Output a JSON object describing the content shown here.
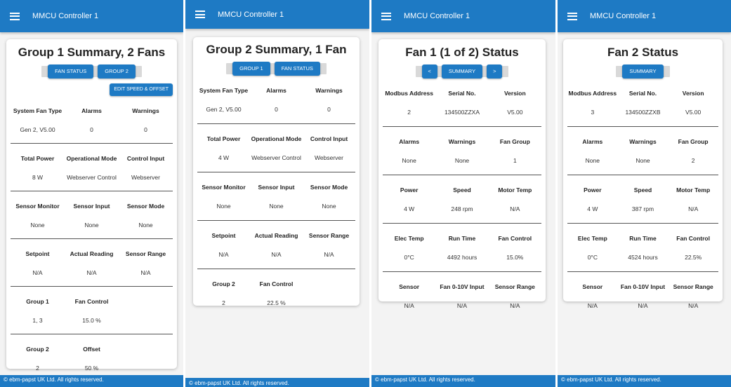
{
  "app_title": "MMCU Controller 1",
  "footer": "© ebm-papst UK Ltd. All rights reserved.",
  "screens": [
    {
      "title": "Group 1 Summary, 2 Fans",
      "buttons": [
        "FAN STATUS",
        "GROUP 2"
      ],
      "edit_button": "EDIT SPEED & OFFSET",
      "rows": [
        {
          "headers": [
            "System Fan Type",
            "Alarms",
            "Warnings"
          ],
          "values": [
            "Gen 2, V5.00",
            "0",
            "0"
          ]
        },
        {
          "headers": [
            "Total Power",
            "Operational Mode",
            "Control Input"
          ],
          "values": [
            "8 W",
            "Webserver Control",
            "Webserver"
          ]
        },
        {
          "headers": [
            "Sensor Monitor",
            "Sensor Input",
            "Sensor Mode"
          ],
          "values": [
            "None",
            "None",
            "None"
          ]
        },
        {
          "headers": [
            "Setpoint",
            "Actual Reading",
            "Sensor Range"
          ],
          "values": [
            "N/A",
            "N/A",
            "N/A"
          ]
        },
        {
          "headers": [
            "Group 1",
            "Fan Control",
            ""
          ],
          "values": [
            "1, 3",
            "15.0 %",
            ""
          ]
        },
        {
          "headers": [
            "Group 2",
            "Offset",
            ""
          ],
          "values": [
            "2",
            "50 %",
            ""
          ]
        }
      ]
    },
    {
      "title": "Group 2 Summary, 1 Fan",
      "buttons": [
        "GROUP 1",
        "FAN STATUS"
      ],
      "rows": [
        {
          "headers": [
            "System Fan Type",
            "Alarms",
            "Warnings"
          ],
          "values": [
            "Gen 2, V5.00",
            "0",
            "0"
          ]
        },
        {
          "headers": [
            "Total Power",
            "Operational Mode",
            "Control Input"
          ],
          "values": [
            "4 W",
            "Webserver Control",
            "Webserver"
          ]
        },
        {
          "headers": [
            "Sensor Monitor",
            "Sensor Input",
            "Sensor Mode"
          ],
          "values": [
            "None",
            "None",
            "None"
          ]
        },
        {
          "headers": [
            "Setpoint",
            "Actual Reading",
            "Sensor Range"
          ],
          "values": [
            "N/A",
            "N/A",
            "N/A"
          ]
        },
        {
          "headers": [
            "Group 2",
            "Fan Control",
            ""
          ],
          "values": [
            "2",
            "22.5 %",
            ""
          ]
        }
      ]
    },
    {
      "title": "Fan 1 (1 of 2) Status",
      "buttons": [
        "<",
        "SUMMARY",
        ">"
      ],
      "rows": [
        {
          "headers": [
            "Modbus Address",
            "Serial No.",
            "Version"
          ],
          "values": [
            "2",
            "134500ZZXA",
            "V5.00"
          ]
        },
        {
          "headers": [
            "Alarms",
            "Warnings",
            "Fan Group"
          ],
          "values": [
            "None",
            "None",
            "1"
          ]
        },
        {
          "headers": [
            "Power",
            "Speed",
            "Motor Temp"
          ],
          "values": [
            "4 W",
            "248 rpm",
            "N/A"
          ]
        },
        {
          "headers": [
            "Elec Temp",
            "Run Time",
            "Fan Control"
          ],
          "values": [
            "0°C",
            "4492 hours",
            "15.0%"
          ]
        },
        {
          "headers": [
            "Sensor",
            "Fan 0-10V Input",
            "Sensor Range"
          ],
          "values": [
            "N/A",
            "N/A",
            "N/A"
          ]
        }
      ]
    },
    {
      "title": "Fan 2 Status",
      "buttons": [
        "SUMMARY"
      ],
      "rows": [
        {
          "headers": [
            "Modbus Address",
            "Serial No.",
            "Version"
          ],
          "values": [
            "3",
            "134500ZZXB",
            "V5.00"
          ]
        },
        {
          "headers": [
            "Alarms",
            "Warnings",
            "Fan Group"
          ],
          "values": [
            "None",
            "None",
            "2"
          ]
        },
        {
          "headers": [
            "Power",
            "Speed",
            "Motor Temp"
          ],
          "values": [
            "4 W",
            "387 rpm",
            "N/A"
          ]
        },
        {
          "headers": [
            "Elec Temp",
            "Run Time",
            "Fan Control"
          ],
          "values": [
            "0°C",
            "4524 hours",
            "22.5%"
          ]
        },
        {
          "headers": [
            "Sensor",
            "Fan 0-10V Input",
            "Sensor Range"
          ],
          "values": [
            "N/A",
            "N/A",
            "N/A"
          ]
        }
      ]
    }
  ]
}
